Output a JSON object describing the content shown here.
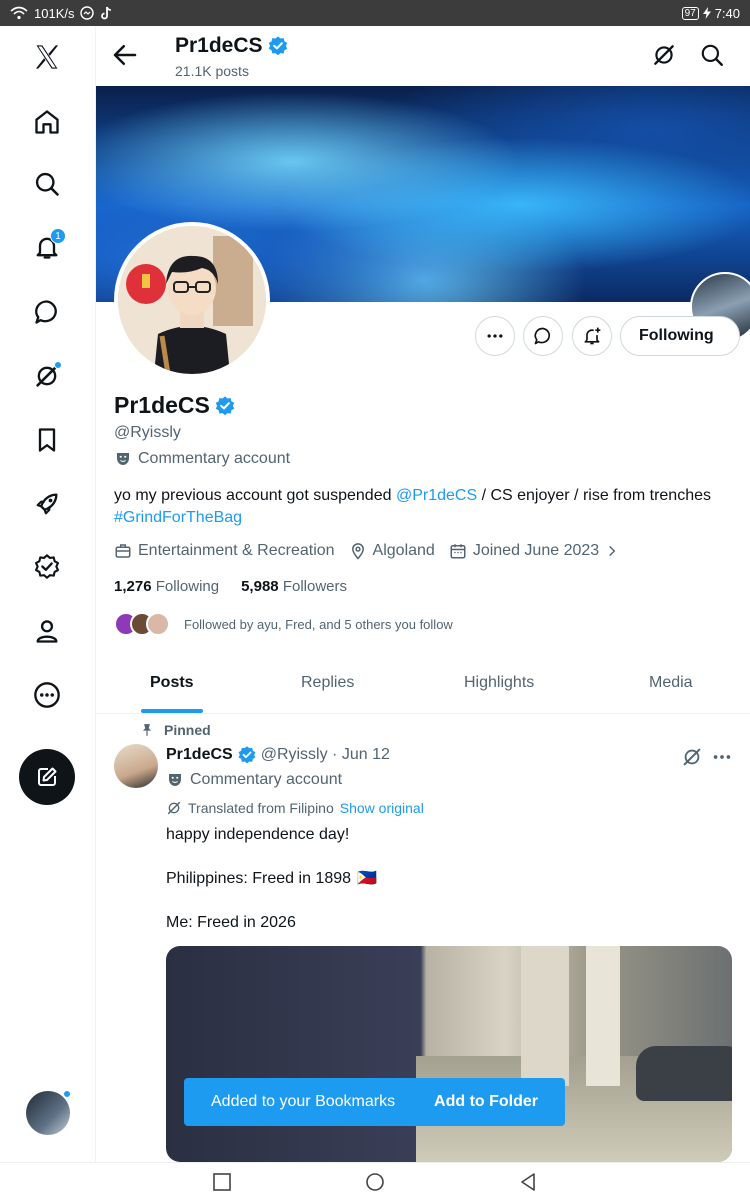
{
  "status_bar": {
    "speed": "101K/s",
    "battery": "97",
    "time": "7:40"
  },
  "colors": {
    "accent": "#1d9bf0",
    "text": "#0f1419",
    "muted": "#536471"
  },
  "rail": {
    "items": [
      "x-logo-icon",
      "home-icon",
      "search-icon",
      "notifications-icon",
      "messages-icon",
      "grok-icon",
      "bookmarks-icon",
      "communities-icon",
      "verified-icon",
      "profile-icon",
      "more-icon"
    ],
    "notifications_badge": "1"
  },
  "header": {
    "name": "Pr1deCS",
    "posts": "21.1K posts"
  },
  "profile": {
    "name": "Pr1deCS",
    "handle": "@Ryissly",
    "label": "Commentary account",
    "following_button": "Following",
    "bio_prefix": "yo my previous account got suspended ",
    "bio_mention": "@Pr1deCS",
    "bio_mid": " / CS enjoyer / rise from trenches ",
    "bio_hashtag": "#GrindForTheBag",
    "category": "Entertainment & Recreation",
    "location": "Algoland",
    "joined": "Joined June 2023",
    "following_count": "1,276",
    "following_label": "Following",
    "followers_count": "5,988",
    "followers_label": "Followers",
    "followed_by": "Followed by ayu, Fred, and 5 others you follow"
  },
  "tabs": [
    "Posts",
    "Replies",
    "Highlights",
    "Media"
  ],
  "post": {
    "pinned": "Pinned",
    "name": "Pr1deCS",
    "handle_date": "@Ryissly · Jun 12",
    "label": "Commentary account",
    "translated": "Translated from Filipino",
    "show_original": "Show original",
    "line1": "happy independence day!",
    "line2": "Philippines: Freed in 1898",
    "flag": "🇵🇭",
    "line3": "Me: Freed in 2026"
  },
  "toast": {
    "message": "Added to your Bookmarks",
    "action": "Add to Folder"
  }
}
